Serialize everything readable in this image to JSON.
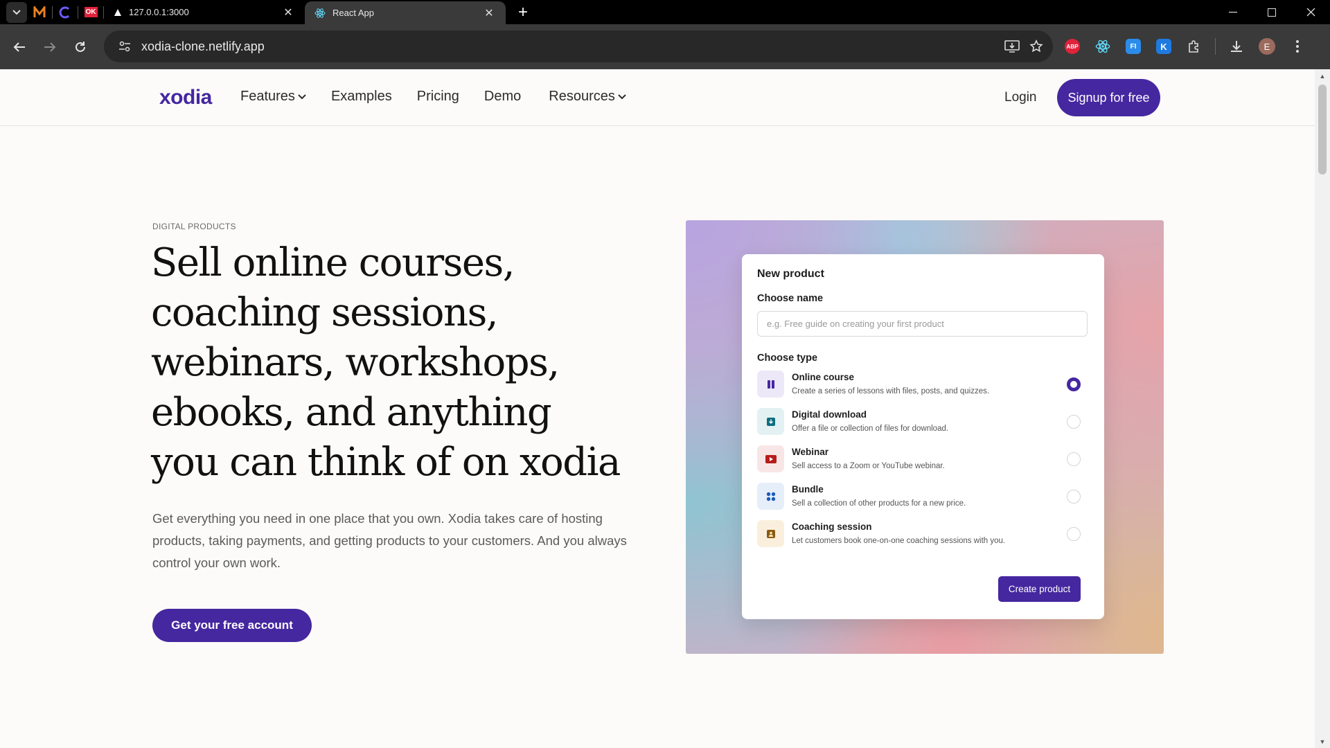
{
  "browser": {
    "tabs": [
      {
        "title": "127.0.0.1:3000",
        "active": false
      },
      {
        "title": "React App",
        "active": true
      }
    ],
    "pinned": [
      {
        "icon": "m-favicon-icon"
      },
      {
        "icon": "c-favicon-icon"
      },
      {
        "icon": "ok-favicon-icon",
        "text": "OK"
      }
    ],
    "url": "xodia-clone.netlify.app",
    "extensions": [
      {
        "icon": "adblock-plus-icon",
        "text": "ABP",
        "color": "#e0223b"
      },
      {
        "icon": "react-devtools-icon",
        "text": "",
        "color": "#61dafb"
      },
      {
        "icon": "fi-extension-icon",
        "text": "FI",
        "color": "#2b8ceb"
      },
      {
        "icon": "k-extension-icon",
        "text": "K",
        "color": "#1f7ae0"
      }
    ],
    "profile_initial": "E"
  },
  "header": {
    "logo": "xodia",
    "nav": [
      {
        "label": "Features",
        "dropdown": true
      },
      {
        "label": "Examples",
        "dropdown": false
      },
      {
        "label": "Pricing",
        "dropdown": false
      },
      {
        "label": "Demo",
        "dropdown": false
      },
      {
        "label": "Resources",
        "dropdown": true
      }
    ],
    "login": "Login",
    "signup": "Signup for free"
  },
  "hero": {
    "eyebrow": "DIGITAL PRODUCTS",
    "headline": "Sell online courses, coaching sessions, webinars, workshops, ebooks, and anything you can think of on xodia",
    "subtext": "Get everything you need in one place that you own. Xodia takes care of hosting products, taking payments, and getting products to your customers. And you always control your own work.",
    "cta": "Get your free account"
  },
  "card": {
    "title": "New product",
    "name_label": "Choose name",
    "name_placeholder": "e.g. Free guide on creating your first product",
    "type_label": "Choose type",
    "types": [
      {
        "name": "Online course",
        "desc": "Create a series of lessons with files, posts, and quizzes.",
        "icon": "course-icon",
        "checked": true
      },
      {
        "name": "Digital download",
        "desc": "Offer a file or collection of files for download.",
        "icon": "download-icon",
        "checked": false
      },
      {
        "name": "Webinar",
        "desc": "Sell access to a Zoom or YouTube webinar.",
        "icon": "play-icon",
        "checked": false
      },
      {
        "name": "Bundle",
        "desc": "Sell a collection of other products for a new price.",
        "icon": "bundle-icon",
        "checked": false
      },
      {
        "name": "Coaching session",
        "desc": "Let customers book one-on-one coaching sessions with you.",
        "icon": "coaching-icon",
        "checked": false
      }
    ],
    "create_button": "Create product"
  },
  "colors": {
    "brand": "#4527a0"
  }
}
